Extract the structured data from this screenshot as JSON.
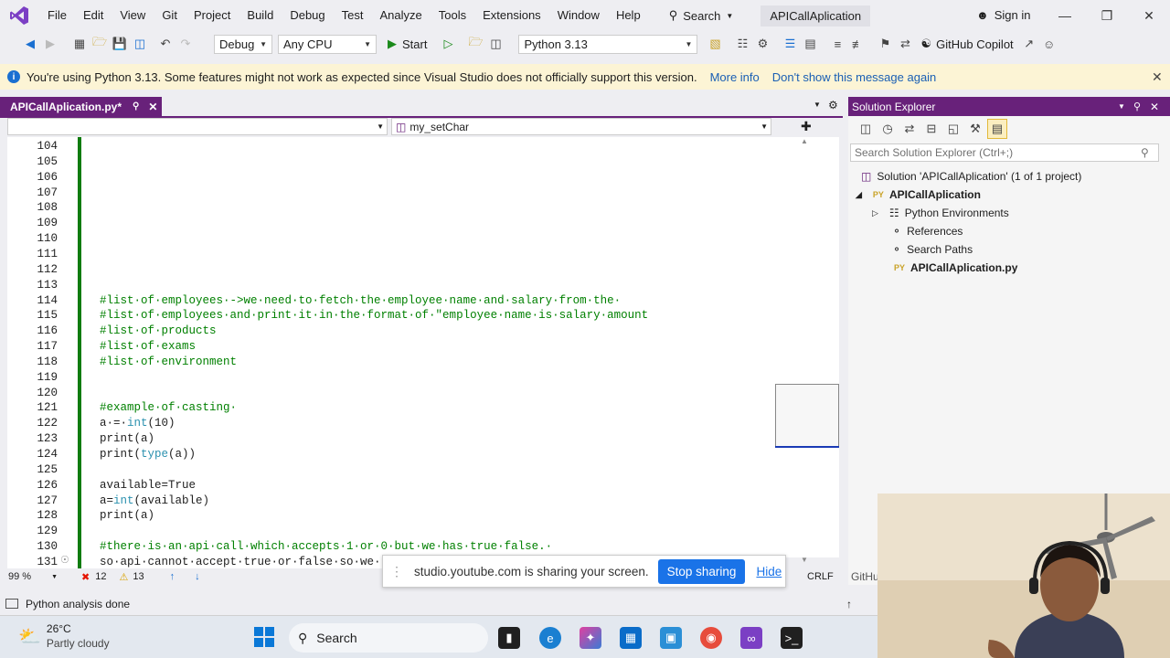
{
  "menu": {
    "items": [
      "File",
      "Edit",
      "View",
      "Git",
      "Project",
      "Build",
      "Debug",
      "Test",
      "Analyze",
      "Tools",
      "Extensions",
      "Window",
      "Help"
    ],
    "search_label": "Search",
    "solution_title": "APICallAplication",
    "signin_label": "Sign in"
  },
  "toolbar": {
    "config": "Debug",
    "platform": "Any CPU",
    "start_label": "Start",
    "environment": "Python 3.13",
    "copilot_label": "GitHub Copilot"
  },
  "infobar": {
    "message": "You're using Python 3.13. Some features might not work as expected since Visual Studio does not officially support this version.",
    "more_info": "More info",
    "dont_show": "Don't show this message again"
  },
  "editor": {
    "tab_label": "APICallAplication.py*",
    "member_combo": "my_setChar",
    "zoom": "99 %",
    "errors": "12",
    "warnings": "13",
    "line_ending": "CRLF",
    "lines": [
      {
        "n": "104",
        "text": "",
        "cls": "plain"
      },
      {
        "n": "105",
        "text": "",
        "cls": "plain"
      },
      {
        "n": "106",
        "text": "",
        "cls": "plain"
      },
      {
        "n": "107",
        "text": "",
        "cls": "plain"
      },
      {
        "n": "108",
        "text": "",
        "cls": "plain"
      },
      {
        "n": "109",
        "text": "",
        "cls": "plain"
      },
      {
        "n": "110",
        "text": "",
        "cls": "plain"
      },
      {
        "n": "111",
        "text": "",
        "cls": "plain"
      },
      {
        "n": "112",
        "text": "",
        "cls": "plain"
      },
      {
        "n": "113",
        "text": "",
        "cls": "plain"
      },
      {
        "n": "114",
        "text": "#list·of·employees·->we·need·to·fetch·the·employee·name·and·salary·from·the·",
        "cls": "cmt"
      },
      {
        "n": "115",
        "text": "#list·of·employees·and·print·it·in·the·format·of·\"employee·name·is·salary·amount",
        "cls": "cmt"
      },
      {
        "n": "116",
        "text": "#list·of·products",
        "cls": "cmt"
      },
      {
        "n": "117",
        "text": "#list·of·exams",
        "cls": "cmt"
      },
      {
        "n": "118",
        "text": "#list·of·environment",
        "cls": "cmt"
      },
      {
        "n": "119",
        "text": "",
        "cls": "plain"
      },
      {
        "n": "120",
        "text": "",
        "cls": "plain"
      },
      {
        "n": "121",
        "text": "#example·of·casting·",
        "cls": "cmt"
      },
      {
        "n": "122",
        "text": "a·=·int(10)",
        "cls": "plain"
      },
      {
        "n": "123",
        "text": "print(a)",
        "cls": "plain"
      },
      {
        "n": "124",
        "text": "print(type(a))",
        "cls": "plain"
      },
      {
        "n": "125",
        "text": "",
        "cls": "plain"
      },
      {
        "n": "126",
        "text": "available=True",
        "cls": "plain"
      },
      {
        "n": "127",
        "text": "a=int(available)",
        "cls": "plain"
      },
      {
        "n": "128",
        "text": "print(a)",
        "cls": "plain"
      },
      {
        "n": "129",
        "text": "",
        "cls": "plain"
      },
      {
        "n": "130",
        "text": "#there·is·an·api·call·which·accepts·1·or·0·but·we·has·true·false.·",
        "cls": "cmt"
      },
      {
        "n": "131",
        "text": "so·api·cannot·accept·true·or·false·so·we·",
        "cls": "plain"
      }
    ]
  },
  "solution_explorer": {
    "title": "Solution Explorer",
    "search_placeholder": "Search Solution Explorer (Ctrl+;)",
    "solution_node": "Solution 'APICallAplication' (1 of 1 project)",
    "project_node": "APICallAplication",
    "children": [
      "Python Environments",
      "References",
      "Search Paths"
    ],
    "file_node": "APICallAplication.py",
    "file_badge": "PY"
  },
  "statusbar": {
    "text": "Python analysis done",
    "right_clip": "GitHu"
  },
  "share_bar": {
    "message": "studio.youtube.com is sharing your screen.",
    "stop_label": "Stop sharing",
    "hide_label": "Hide"
  },
  "taskbar": {
    "temperature": "26°C",
    "weather": "Partly cloudy",
    "search_label": "Search"
  }
}
